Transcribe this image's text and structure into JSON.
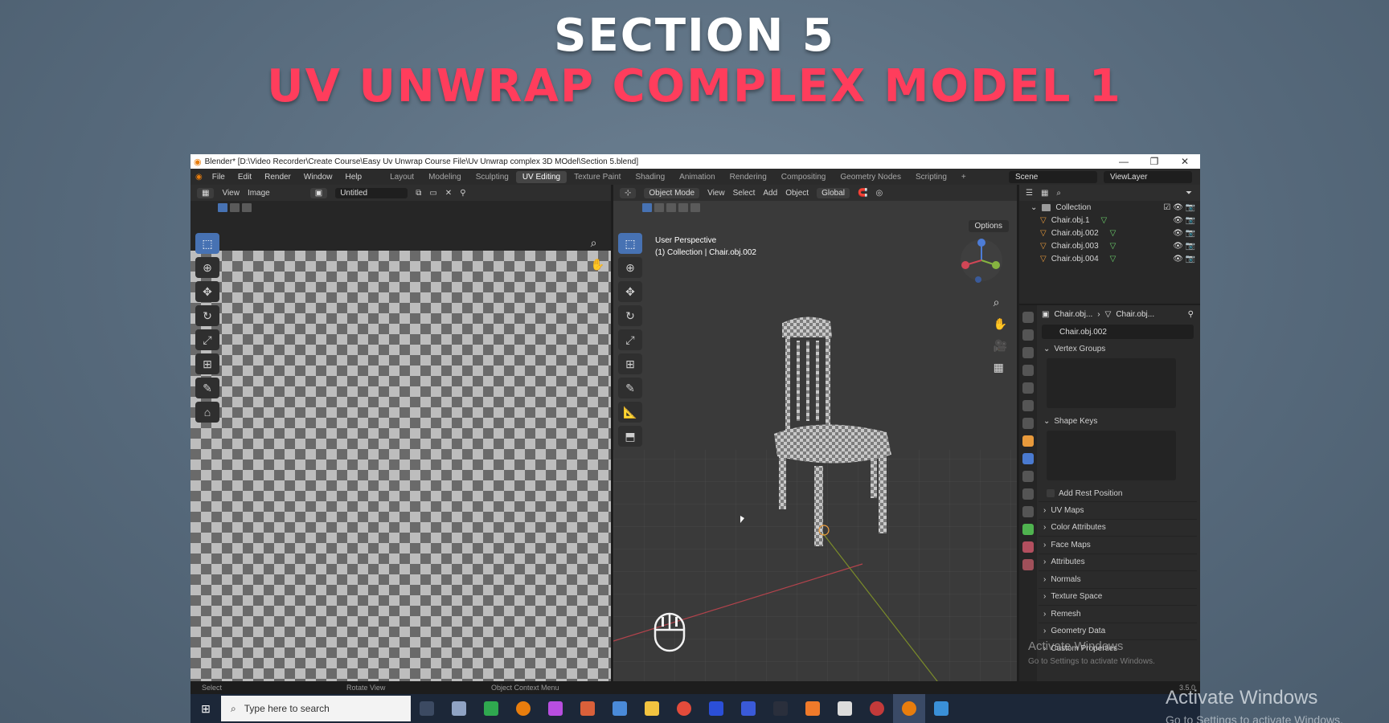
{
  "slide": {
    "title_line1": "SECTION 5",
    "title_line2": "UV UNWRAP COMPLEX MODEL 1",
    "watermark_title": "Activate Windows",
    "watermark_sub": "Go to Settings to activate Windows."
  },
  "window": {
    "title": "Blender* [D:\\Video Recorder\\Create Course\\Easy Uv Unwrap Course File\\Uv Unwrap complex 3D MOdel\\Section 5.blend]",
    "minimize": "—",
    "maximize": "❐",
    "close": "✕"
  },
  "menu": {
    "items": [
      "File",
      "Edit",
      "Render",
      "Window",
      "Help"
    ],
    "workspaces": [
      "Layout",
      "Modeling",
      "Sculpting",
      "UV Editing",
      "Texture Paint",
      "Shading",
      "Animation",
      "Rendering",
      "Compositing",
      "Geometry Nodes",
      "Scripting"
    ],
    "active_workspace": "UV Editing",
    "add_tab": "+",
    "scene": "Scene",
    "view_layer": "ViewLayer"
  },
  "uv_editor": {
    "header_items": [
      "View",
      "Image"
    ],
    "image_name": "Untitled"
  },
  "viewport": {
    "mode": "Object Mode",
    "header_items": [
      "View",
      "Select",
      "Add",
      "Object"
    ],
    "orientation": "Global",
    "options": "Options",
    "perspective": "User Perspective",
    "collection_info": "(1) Collection | Chair.obj.002"
  },
  "outliner": {
    "collection": "Collection",
    "objects": [
      "Chair.obj.1",
      "Chair.obj.002",
      "Chair.obj.003",
      "Chair.obj.004"
    ]
  },
  "properties": {
    "breadcrumb_object": "Chair.obj...",
    "breadcrumb_mesh": "Chair.obj...",
    "mesh_name": "Chair.obj.002",
    "vertex_groups": "Vertex Groups",
    "shape_keys": "Shape Keys",
    "add_rest_position": "Add Rest Position",
    "sections": [
      "UV Maps",
      "Color Attributes",
      "Face Maps",
      "Attributes",
      "Normals",
      "Texture Space",
      "Remesh",
      "Geometry Data",
      "Custom Properties"
    ]
  },
  "status": {
    "select": "Select",
    "rotate": "Rotate View",
    "context": "Object Context Menu",
    "version": "3.5.0"
  },
  "taskbar": {
    "search_placeholder": "Type here to search"
  },
  "colors": {
    "accent_blue": "#4772b3",
    "title_red": "#ff3d5c",
    "blender_orange": "#e87d0d"
  }
}
